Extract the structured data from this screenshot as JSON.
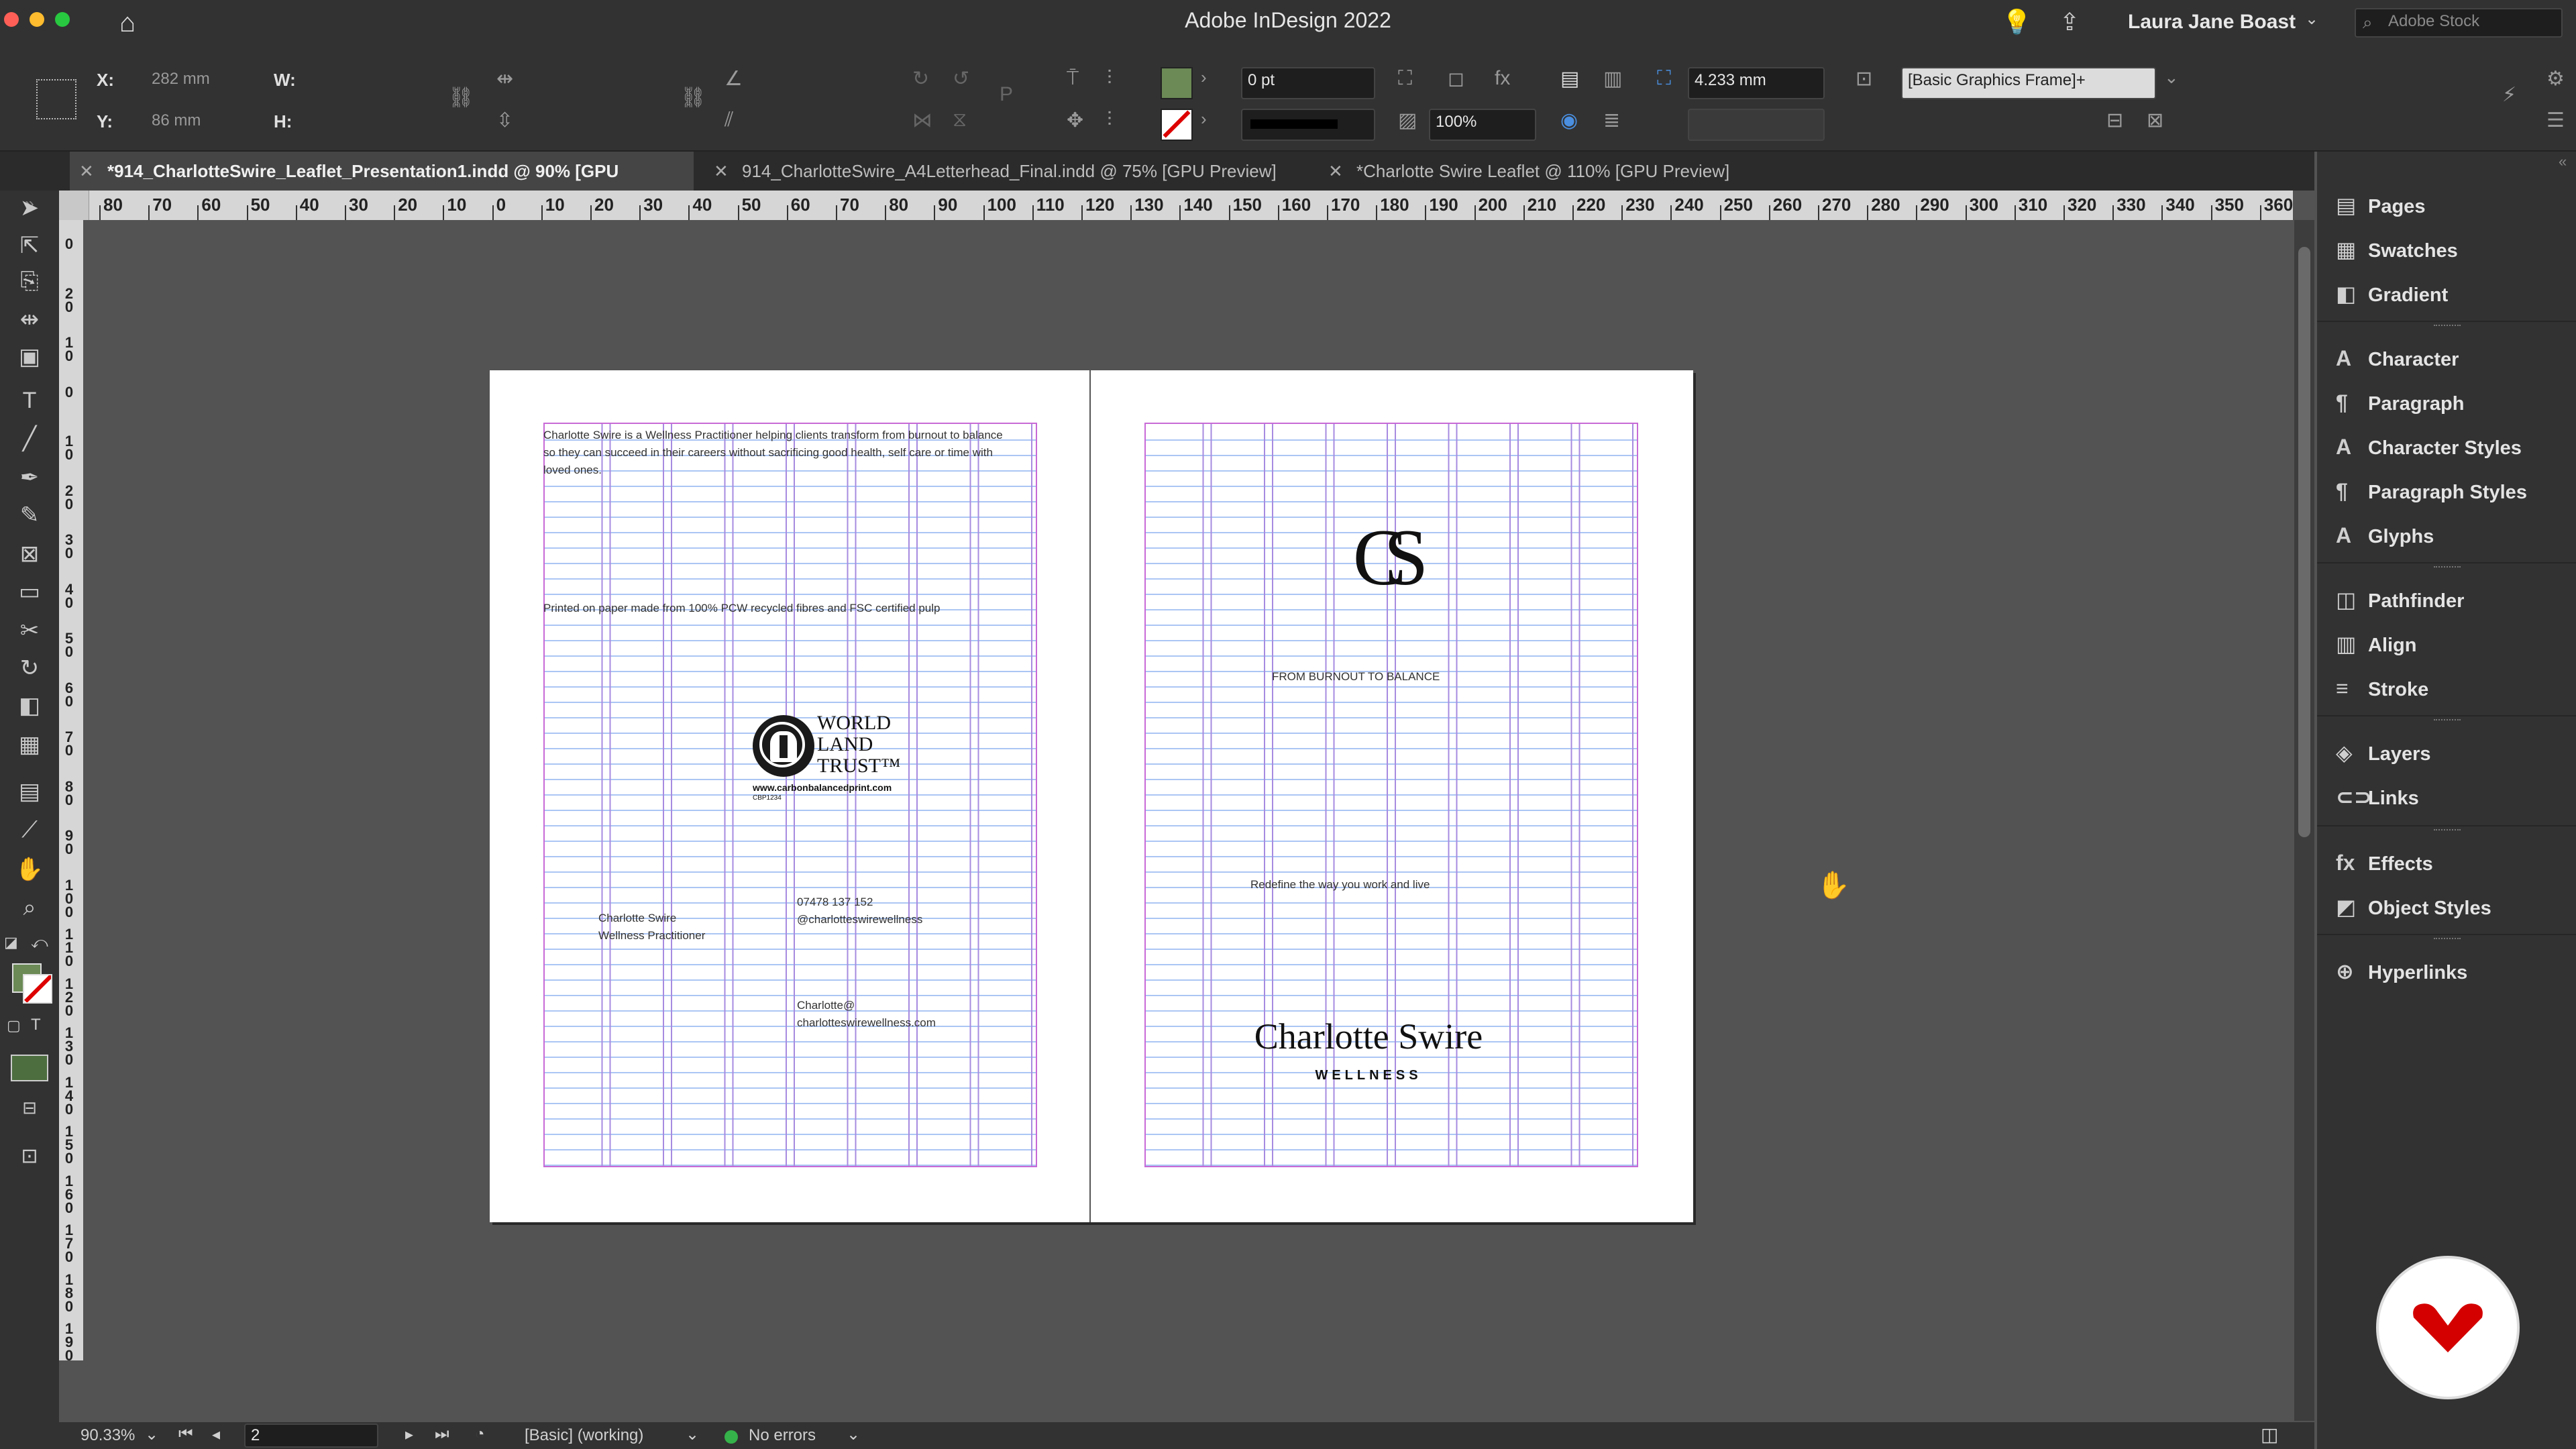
{
  "app_title": "Adobe InDesign 2022",
  "user_name": "Laura Jane Boast",
  "search_placeholder": "Adobe Stock",
  "control": {
    "x_label": "X:",
    "x_value": "282 mm",
    "y_label": "Y:",
    "y_value": "86 mm",
    "w_label": "W:",
    "h_label": "H:",
    "stroke_weight": "0 pt",
    "opacity": "100%",
    "gap_value": "4.233 mm",
    "object_style": "[Basic Graphics Frame]+"
  },
  "tabs": [
    {
      "label": "*914_CharlotteSwire_Leaflet_Presentation1.indd @ 90% [GPU Preview]",
      "active": true
    },
    {
      "label": "914_CharlotteSwire_A4Letterhead_Final.indd @ 75% [GPU Preview]",
      "active": false
    },
    {
      "label": "*Charlotte Swire Leaflet @ 110% [GPU Preview]",
      "active": false
    }
  ],
  "ruler_h": [
    "80",
    "70",
    "60",
    "50",
    "40",
    "30",
    "20",
    "10",
    "0",
    "10",
    "20",
    "30",
    "40",
    "50",
    "60",
    "70",
    "80",
    "90",
    "100",
    "110",
    "120",
    "130",
    "140",
    "150",
    "160",
    "170",
    "180",
    "190",
    "200",
    "210",
    "220",
    "230",
    "240",
    "250",
    "260",
    "270",
    "280",
    "290",
    "300",
    "310",
    "320",
    "330",
    "340",
    "350",
    "360"
  ],
  "ruler_v": [
    "0",
    "20",
    "10",
    "0",
    "10",
    "20",
    "30",
    "40",
    "50",
    "60",
    "70",
    "80",
    "90",
    "100",
    "110",
    "120",
    "130",
    "140",
    "150",
    "160",
    "170",
    "180",
    "190"
  ],
  "left_page": {
    "intro": "Charlotte Swire is a Wellness Practitioner helping clients transform from burnout to balance so they can succeed in their careers without sacrificing good health, self care or time with loved ones.",
    "printed": "Printed on paper made from 100% PCW recycled fibres and FSC certified pulp",
    "wlt_line1": "WORLD",
    "wlt_line2": "LAND",
    "wlt_line3": "TRUST™",
    "wlt_url": "www.carbonbalancedprint.com",
    "wlt_code": "CBP1234",
    "name": "Charlotte Swire",
    "role": "Wellness Practitioner",
    "phone": "07478 137 152",
    "handle": "@charlotteswirewellness",
    "email_1": "Charlotte@",
    "email_2": "charlotteswirewellness.com"
  },
  "right_page": {
    "monogram": "CS",
    "tagline": "FROM BURNOUT TO BALANCE",
    "redefine": "Redefine the way you work and live",
    "brand": "Charlotte Swire",
    "brand_sub": "WELLNESS"
  },
  "status": {
    "zoom": "90.33%",
    "page": "2",
    "preflight_profile": "[Basic] (working)",
    "errors": "No errors"
  },
  "panels": [
    {
      "label": "Pages",
      "icon": "pages-icon",
      "glyph": "▤"
    },
    {
      "label": "Swatches",
      "icon": "swatches-icon",
      "glyph": "▦"
    },
    {
      "label": "Gradient",
      "icon": "gradient-icon",
      "glyph": "◧"
    },
    {
      "label": "Character",
      "icon": "character-icon",
      "glyph": "A"
    },
    {
      "label": "Paragraph",
      "icon": "paragraph-icon",
      "glyph": "¶"
    },
    {
      "label": "Character Styles",
      "icon": "character-styles-icon",
      "glyph": "A"
    },
    {
      "label": "Paragraph Styles",
      "icon": "paragraph-styles-icon",
      "glyph": "¶"
    },
    {
      "label": "Glyphs",
      "icon": "glyphs-icon",
      "glyph": "A"
    },
    {
      "label": "Pathfinder",
      "icon": "pathfinder-icon",
      "glyph": "◫"
    },
    {
      "label": "Align",
      "icon": "align-icon",
      "glyph": "▥"
    },
    {
      "label": "Stroke",
      "icon": "stroke-icon",
      "glyph": "≡"
    },
    {
      "label": "Layers",
      "icon": "layers-icon",
      "glyph": "◈"
    },
    {
      "label": "Links",
      "icon": "links-icon",
      "glyph": "⊂⊃"
    },
    {
      "label": "Effects",
      "icon": "effects-icon",
      "glyph": "fx"
    },
    {
      "label": "Object Styles",
      "icon": "object-styles-icon",
      "glyph": "◩"
    },
    {
      "label": "Hyperlinks",
      "icon": "hyperlinks-icon",
      "glyph": "⊕"
    }
  ],
  "colors": {
    "chrome": "#323232",
    "canvas": "#535353",
    "margin_guide": "#c86ad6",
    "column_guide": "#a78be0",
    "baseline_guide": "#8fb4f0",
    "brand_red": "#d40000"
  }
}
